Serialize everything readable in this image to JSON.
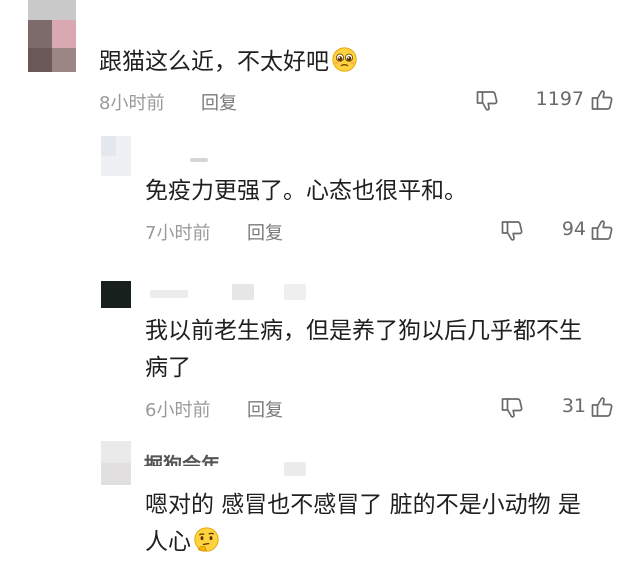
{
  "comments": [
    {
      "text": "跟猫这么近，不太好吧",
      "emoji": "pleading-face-emoji",
      "time": "8小时前",
      "reply": "回复",
      "likes": "1197"
    },
    {
      "text": "免疫力更强了。心态也很平和。",
      "time": "7小时前",
      "reply": "回复",
      "likes": "94"
    },
    {
      "text_line1": "我以前老生病，但是养了狗以后几乎都不生",
      "text_line2": "病了",
      "time": "6小时前",
      "reply": "回复",
      "likes": "31"
    },
    {
      "text_line1": "嗯对的 感冒也不感冒了 脏的不是小动物 是",
      "text_line2": "人心",
      "emoji": "thinking-face-emoji",
      "username_fragment": "掘狗会年"
    }
  ],
  "icons": {
    "dislike": "thumbs-down-icon",
    "like": "thumbs-up-icon"
  }
}
